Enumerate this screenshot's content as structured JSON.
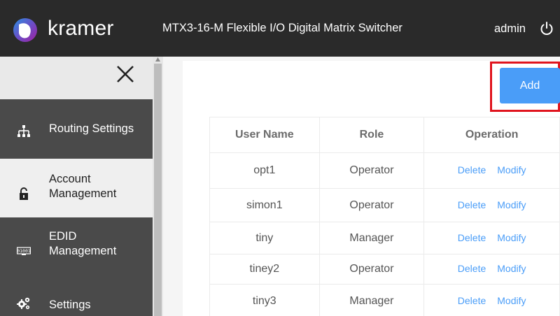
{
  "header": {
    "brand": "kramer",
    "title": "MTX3-16-M Flexible I/O Digital Matrix Switcher",
    "user": "admin"
  },
  "sidebar": {
    "items": [
      {
        "label": "Routing Settings",
        "icon": "network-tree-icon"
      },
      {
        "label_line1": "Account",
        "label_line2": "Management",
        "icon": "lock-icon"
      },
      {
        "label_line1": "EDID",
        "label_line2": "Management",
        "icon": "edid-icon"
      },
      {
        "label": "Settings",
        "icon": "gears-icon"
      }
    ]
  },
  "main": {
    "add_label": "Add",
    "table": {
      "headers": [
        "User Name",
        "Role",
        "Operation"
      ],
      "rows": [
        {
          "user": "opt1",
          "role": "Operator"
        },
        {
          "user": "simon1",
          "role": "Operator"
        },
        {
          "user": "tiny",
          "role": "Manager"
        },
        {
          "user": "tiney2",
          "role": "Operator"
        },
        {
          "user": "tiny3",
          "role": "Manager"
        }
      ],
      "delete_label": "Delete",
      "modify_label": "Modify"
    }
  },
  "colors": {
    "accent": "#4a9df8",
    "highlight": "#e0141e",
    "header_bg": "#2a2a2a"
  }
}
